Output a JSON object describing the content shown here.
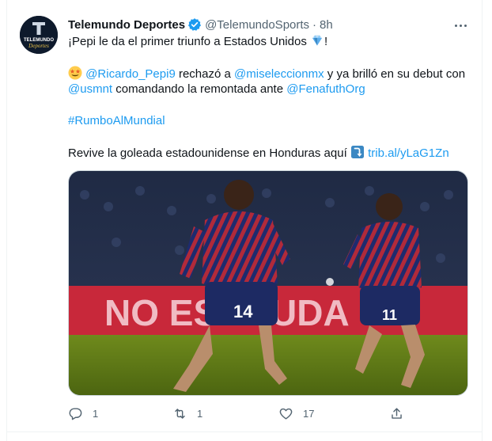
{
  "tweet": {
    "display_name": "Telemundo Deportes",
    "handle": "@TelemundoSports",
    "separator": "·",
    "time": "8h",
    "avatar_text_top": "TELEMUNDO",
    "avatar_text_bottom": "Deportes",
    "line1": "¡Pepi le da el primer triunfo a Estados Unidos ",
    "line1_end": "!",
    "line2": {
      "mention1": "@Ricardo_Pepi9",
      "t1": " rechazó a ",
      "mention2": "@miseleccionmx",
      "t2": " y ya brilló en su debut con"
    },
    "line3": {
      "mention3": "@usmnt",
      "t3": " comandando la remontada ante ",
      "mention4": "@FenafuthOrg"
    },
    "hashtag": "#RumboAlMundial",
    "line5_text": "Revive la goleada estadounidense en Honduras aquí ",
    "link": "trib.al/yLaG1Zn",
    "media": {
      "banner_text": "NO ES",
      "banner_text2": "UDA",
      "player1_number": "14",
      "player2_number": "11"
    }
  },
  "actions": {
    "reply_count": "1",
    "retweet_count": "1",
    "like_count": "17"
  },
  "colors": {
    "accent": "#1d9bf0",
    "muted": "#536471",
    "text": "#0f1419"
  }
}
